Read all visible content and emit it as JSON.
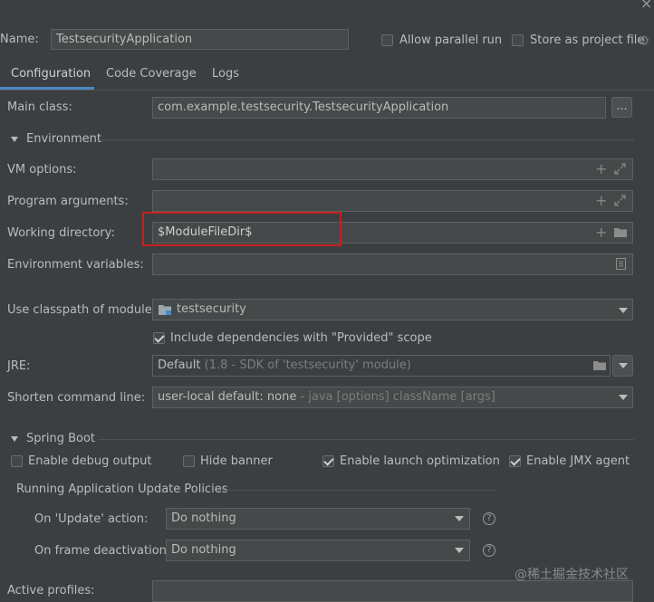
{
  "header": {
    "name_label": "Name:",
    "name_value": "TestsecurityApplication",
    "allow_parallel_label": "Allow parallel run",
    "store_project_label": "Store as project file",
    "close_glyph": "×"
  },
  "tabs": [
    {
      "label": "Configuration",
      "active": true
    },
    {
      "label": "Code Coverage",
      "active": false
    },
    {
      "label": "Logs",
      "active": false
    }
  ],
  "main_class": {
    "label": "Main class:",
    "value": "com.example.testsecurity.TestsecurityApplication",
    "browse_label": "..."
  },
  "environment": {
    "section_label": "Environment",
    "vm_options_label": "VM options:",
    "program_args_label": "Program arguments:",
    "working_dir_label": "Working directory:",
    "working_dir_value": "$ModuleFileDir$",
    "env_vars_label": "Environment variables:"
  },
  "classpath": {
    "label": "Use classpath of module:",
    "value": "testsecurity",
    "include_provided_label": "Include dependencies with \"Provided\" scope",
    "include_provided_checked": true
  },
  "jre": {
    "label": "JRE:",
    "value": "Default",
    "hint": "(1.8 - SDK of 'testsecurity' module)"
  },
  "shorten": {
    "label": "Shorten command line:",
    "value": "user-local default: none",
    "hint": " - java [options] className [args]"
  },
  "spring_boot": {
    "section_label": "Spring Boot",
    "debug_output_label": "Enable debug output",
    "debug_output_checked": false,
    "hide_banner_label": "Hide banner",
    "hide_banner_checked": false,
    "launch_opt_label": "Enable launch optimization",
    "launch_opt_checked": true,
    "jmx_label": "Enable JMX agent",
    "jmx_checked": true,
    "policies_label": "Running Application Update Policies",
    "on_update_label": "On 'Update' action:",
    "on_update_value": "Do nothing",
    "on_frame_label": "On frame deactivation:",
    "on_frame_value": "Do nothing",
    "active_profiles_label": "Active profiles:"
  },
  "watermark": "@稀土掘金技术社区",
  "colors": {
    "background": "#3c3f41",
    "tab_underline": "#4a88c7",
    "highlight_box": "#c8201f"
  }
}
